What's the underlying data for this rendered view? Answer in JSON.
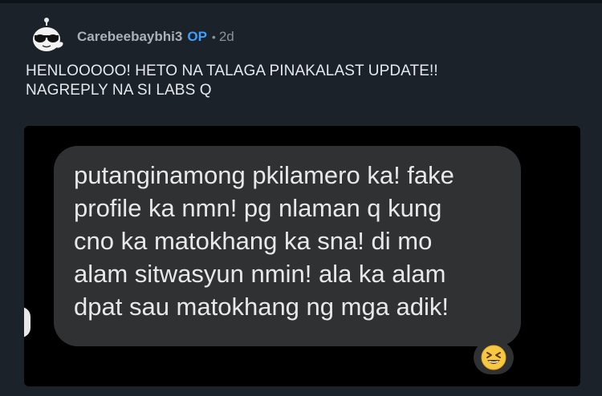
{
  "comment": {
    "username": "Carebeebaybhi3",
    "op_badge": "OP",
    "separator": "•",
    "age": "2d",
    "body_lines": [
      "HENLOOOOO! HETO NA TALAGA PINAKALAST UPDATE!!",
      "NAGREPLY NA SI LABS Q"
    ]
  },
  "image": {
    "message_lines": [
      "putanginamong pkilamero ka! fake",
      "profile ka nmn! pg nlaman q kung",
      "cno ka matokhang ka sna! di mo",
      "alam sitwasyun nmin! ala ka alam",
      "dpat sau matokhang ng mga adik!"
    ],
    "reaction_icon": "grinning-squinting-face-emoji"
  },
  "colors": {
    "background": "#1b222a",
    "op_badge": "#3f9fff",
    "bubble": "#2f3133"
  }
}
